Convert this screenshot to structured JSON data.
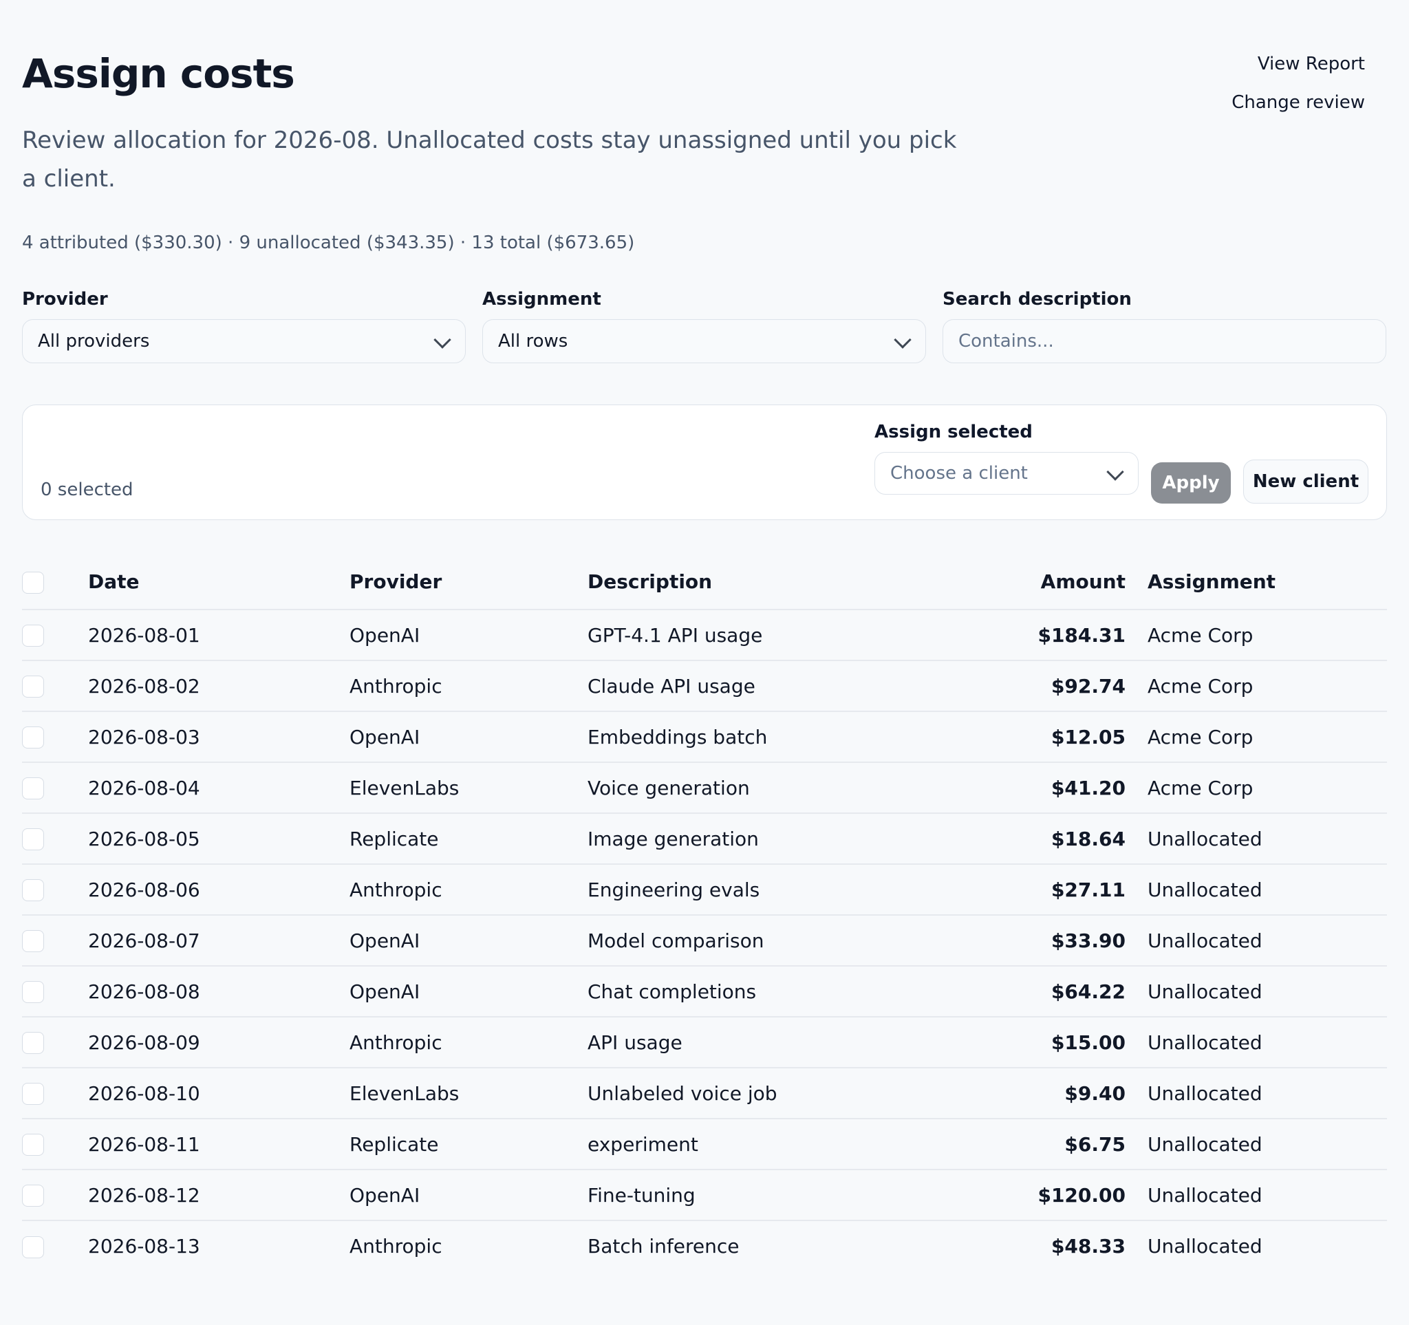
{
  "header": {
    "title": "Assign costs",
    "subtitle": "Review allocation for 2026-08. Unallocated costs stay unassigned until you pick a client.",
    "summary": "4 attributed ($330.30) · 9 unallocated ($343.35) · 13 total ($673.65)",
    "actions": {
      "view_report": "View Report",
      "change_review": "Change review"
    }
  },
  "filters": {
    "provider": {
      "label": "Provider",
      "value": "All providers"
    },
    "assignment": {
      "label": "Assignment",
      "value": "All rows"
    },
    "search": {
      "label": "Search description",
      "placeholder": "Contains..."
    }
  },
  "bulk": {
    "selected": "0 selected",
    "assign_label": "Assign selected",
    "client_placeholder": "Choose a client",
    "apply": "Apply",
    "new_client": "New client"
  },
  "table": {
    "headers": {
      "date": "Date",
      "provider": "Provider",
      "description": "Description",
      "amount": "Amount",
      "assignment": "Assignment"
    },
    "rows": [
      {
        "date": "2026-08-01",
        "provider": "OpenAI",
        "description": "GPT-4.1 API usage",
        "amount": "$184.31",
        "assignment": "Acme Corp"
      },
      {
        "date": "2026-08-02",
        "provider": "Anthropic",
        "description": "Claude API usage",
        "amount": "$92.74",
        "assignment": "Acme Corp"
      },
      {
        "date": "2026-08-03",
        "provider": "OpenAI",
        "description": "Embeddings batch",
        "amount": "$12.05",
        "assignment": "Acme Corp"
      },
      {
        "date": "2026-08-04",
        "provider": "ElevenLabs",
        "description": "Voice generation",
        "amount": "$41.20",
        "assignment": "Acme Corp"
      },
      {
        "date": "2026-08-05",
        "provider": "Replicate",
        "description": "Image generation",
        "amount": "$18.64",
        "assignment": "Unallocated"
      },
      {
        "date": "2026-08-06",
        "provider": "Anthropic",
        "description": "Engineering evals",
        "amount": "$27.11",
        "assignment": "Unallocated"
      },
      {
        "date": "2026-08-07",
        "provider": "OpenAI",
        "description": "Model comparison",
        "amount": "$33.90",
        "assignment": "Unallocated"
      },
      {
        "date": "2026-08-08",
        "provider": "OpenAI",
        "description": "Chat completions",
        "amount": "$64.22",
        "assignment": "Unallocated"
      },
      {
        "date": "2026-08-09",
        "provider": "Anthropic",
        "description": "API usage",
        "amount": "$15.00",
        "assignment": "Unallocated"
      },
      {
        "date": "2026-08-10",
        "provider": "ElevenLabs",
        "description": "Unlabeled voice job",
        "amount": "$9.40",
        "assignment": "Unallocated"
      },
      {
        "date": "2026-08-11",
        "provider": "Replicate",
        "description": "experiment",
        "amount": "$6.75",
        "assignment": "Unallocated"
      },
      {
        "date": "2026-08-12",
        "provider": "OpenAI",
        "description": "Fine-tuning",
        "amount": "$120.00",
        "assignment": "Unallocated"
      },
      {
        "date": "2026-08-13",
        "provider": "Anthropic",
        "description": "Batch inference",
        "amount": "$48.33",
        "assignment": "Unallocated"
      }
    ]
  }
}
